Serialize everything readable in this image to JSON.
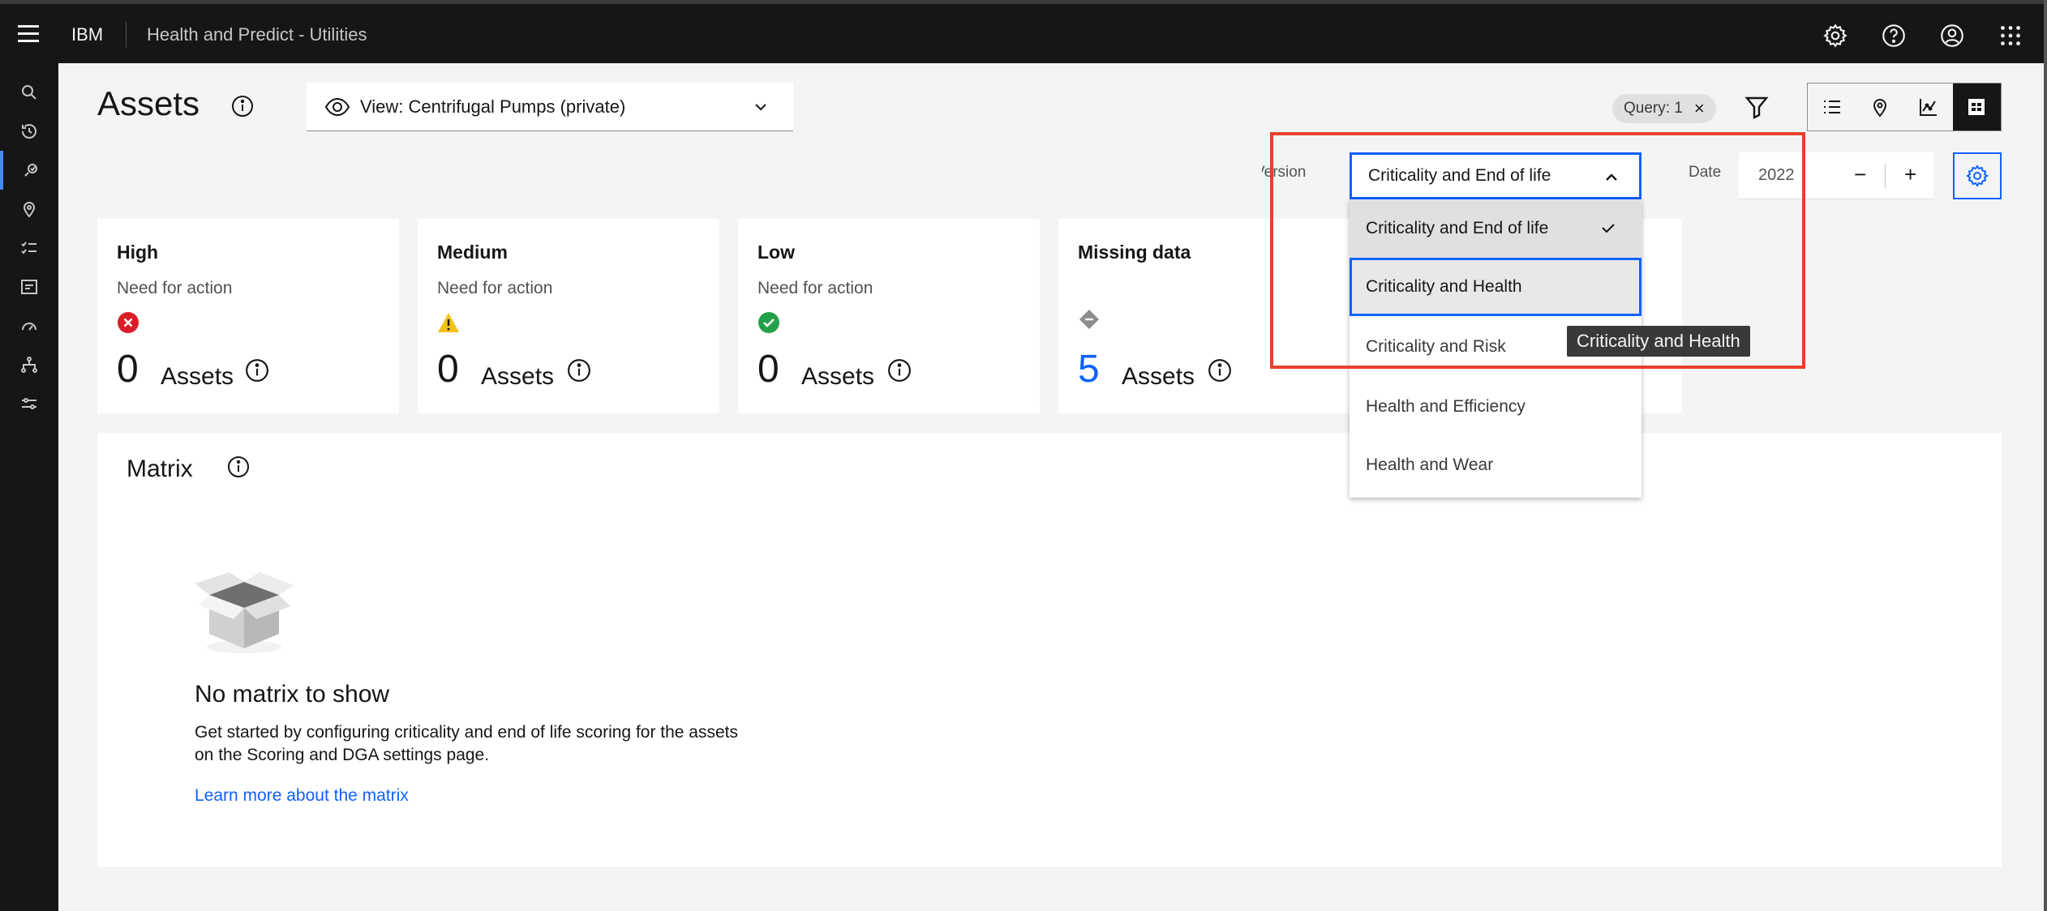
{
  "header": {
    "brand": "IBM",
    "app_title": "Health and Predict - Utilities"
  },
  "page": {
    "title": "Assets",
    "view_label": "View: Centrifugal Pumps (private)",
    "query_tag": "Query: 1"
  },
  "toolbar": {
    "version_label": "Version",
    "version_value": "Criticality and End of life",
    "date_label": "Date",
    "date_value": "2022",
    "date_minus": "−",
    "date_plus": "+"
  },
  "cards": [
    {
      "title": "High",
      "subtitle": "Need for action",
      "count": "0",
      "unit": "Assets",
      "status_icon": "error-icon",
      "color": "#da1e28"
    },
    {
      "title": "Medium",
      "subtitle": "Need for action",
      "count": "0",
      "unit": "Assets",
      "status_icon": "warning-icon",
      "color": "#f1c21b"
    },
    {
      "title": "Low",
      "subtitle": "Need for action",
      "count": "0",
      "unit": "Assets",
      "status_icon": "checkmark-icon",
      "color": "#24a148"
    },
    {
      "title": "Missing data",
      "subtitle": "",
      "count": "5",
      "unit": "Assets",
      "status_icon": "diamond-icon",
      "color": "#0f62fe"
    }
  ],
  "matrix": {
    "title": "Matrix",
    "empty_title": "No matrix to show",
    "empty_desc_line1": "Get started by configuring criticality and end of life scoring for the assets",
    "empty_desc_line2": "on the Scoring and DGA settings page.",
    "learn_more": "Learn more about the matrix"
  },
  "version_menu": {
    "options": [
      "Criticality and End of life",
      "Criticality and Health",
      "Criticality and Risk",
      "Health and Efficiency",
      "Health and Wear"
    ],
    "selected": "Criticality and End of life",
    "focused": "Criticality and Health"
  },
  "tooltip": "Criticality and Health",
  "colors": {
    "accent": "#0f62fe",
    "highlight": "#e8402d"
  }
}
